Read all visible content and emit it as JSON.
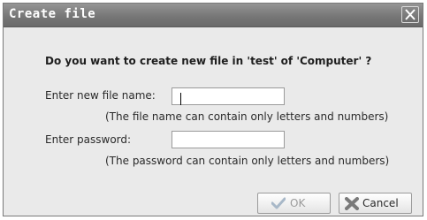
{
  "dialog": {
    "title": "Create file",
    "question": "Do you want to create new file in 'test' of 'Computer' ?"
  },
  "form": {
    "file_name_label": "Enter new file name:",
    "file_name_value": "",
    "file_name_hint": "(The file name can contain only letters and numbers)",
    "password_label": "Enter password:",
    "password_value": "",
    "password_hint": "(The password can contain only letters and numbers)"
  },
  "buttons": {
    "ok_label": "OK",
    "cancel_label": "Cancel"
  },
  "icons": {
    "close": "close-icon",
    "ok": "checkmark-icon",
    "cancel": "cross-icon"
  },
  "colors": {
    "titlebar": "#7a7a7a",
    "dialog_bg": "#eaeaea"
  }
}
